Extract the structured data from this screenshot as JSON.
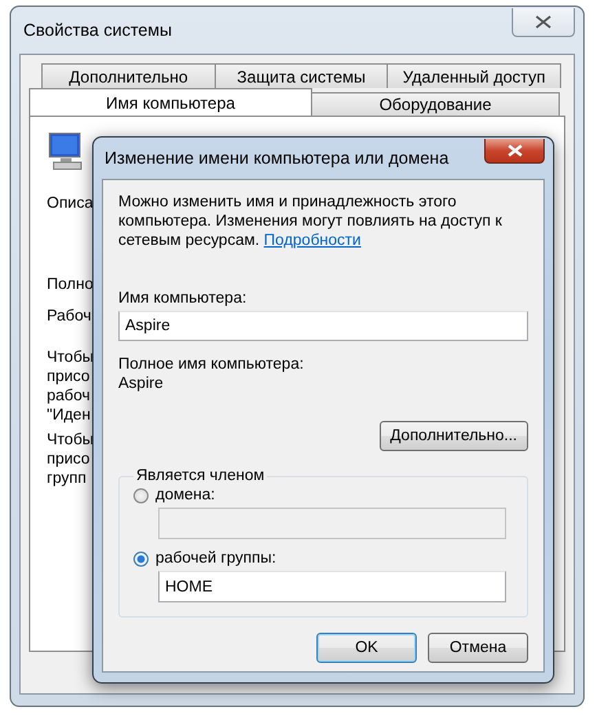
{
  "window": {
    "title": "Свойства системы"
  },
  "tabs_row1": [
    {
      "label": "Дополнительно",
      "selected": false
    },
    {
      "label": "Защита системы",
      "selected": false
    },
    {
      "label": "Удаленный доступ",
      "selected": false
    }
  ],
  "tabs_row2": [
    {
      "label": "Имя компьютера",
      "selected": true
    },
    {
      "label": "Оборудование",
      "selected": false
    }
  ],
  "panel_texts": [
    {
      "lines": [
        "Описа"
      ]
    },
    {
      "lines": [
        "Полно"
      ]
    },
    {
      "lines": [
        "Рабоч"
      ]
    },
    {
      "lines": [
        "Чтобы",
        "присо",
        "рабоч",
        "\"Иден"
      ]
    },
    {
      "lines": [
        "Чтобы",
        "присо",
        "групп"
      ]
    }
  ],
  "dialog": {
    "title": "Изменение имени компьютера или домена",
    "description": "Можно изменить имя и принадлежность этого компьютера. Изменения могут повлиять на доступ к сетевым ресурсам.",
    "link": "Подробности",
    "name_label": "Имя компьютера:",
    "name_value": "Aspire",
    "full_name_label": "Полное имя компьютера:",
    "full_name": "Aspire",
    "more_button": "Дополнительно...",
    "member_group": {
      "legend": "Является членом",
      "options": [
        {
          "label": "домена:",
          "selected": false,
          "field_disabled": true
        },
        {
          "label": "рабочей группы:",
          "selected": true,
          "field_disabled": false,
          "value": "HOME"
        }
      ]
    },
    "buttons": [
      {
        "label": "OK",
        "default": true
      },
      {
        "label": "Отмена",
        "default": false
      }
    ]
  }
}
